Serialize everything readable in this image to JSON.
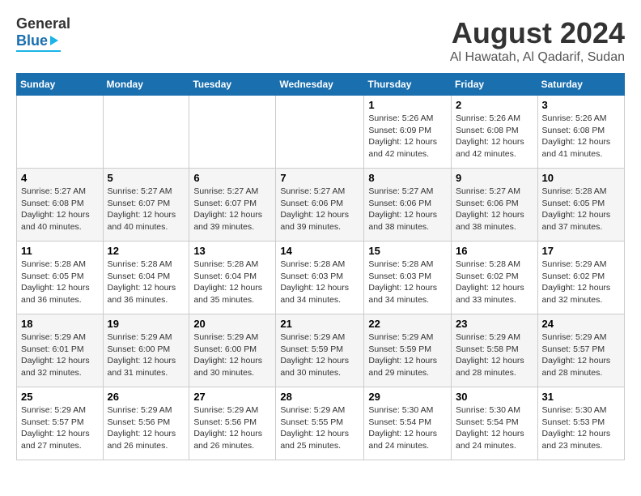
{
  "header": {
    "logo_general": "General",
    "logo_blue": "Blue",
    "title": "August 2024",
    "subtitle": "Al Hawatah, Al Qadarif, Sudan"
  },
  "calendar": {
    "days_of_week": [
      "Sunday",
      "Monday",
      "Tuesday",
      "Wednesday",
      "Thursday",
      "Friday",
      "Saturday"
    ],
    "weeks": [
      [
        {
          "day": "",
          "info": ""
        },
        {
          "day": "",
          "info": ""
        },
        {
          "day": "",
          "info": ""
        },
        {
          "day": "",
          "info": ""
        },
        {
          "day": "1",
          "info": "Sunrise: 5:26 AM\nSunset: 6:09 PM\nDaylight: 12 hours\nand 42 minutes."
        },
        {
          "day": "2",
          "info": "Sunrise: 5:26 AM\nSunset: 6:08 PM\nDaylight: 12 hours\nand 42 minutes."
        },
        {
          "day": "3",
          "info": "Sunrise: 5:26 AM\nSunset: 6:08 PM\nDaylight: 12 hours\nand 41 minutes."
        }
      ],
      [
        {
          "day": "4",
          "info": "Sunrise: 5:27 AM\nSunset: 6:08 PM\nDaylight: 12 hours\nand 40 minutes."
        },
        {
          "day": "5",
          "info": "Sunrise: 5:27 AM\nSunset: 6:07 PM\nDaylight: 12 hours\nand 40 minutes."
        },
        {
          "day": "6",
          "info": "Sunrise: 5:27 AM\nSunset: 6:07 PM\nDaylight: 12 hours\nand 39 minutes."
        },
        {
          "day": "7",
          "info": "Sunrise: 5:27 AM\nSunset: 6:06 PM\nDaylight: 12 hours\nand 39 minutes."
        },
        {
          "day": "8",
          "info": "Sunrise: 5:27 AM\nSunset: 6:06 PM\nDaylight: 12 hours\nand 38 minutes."
        },
        {
          "day": "9",
          "info": "Sunrise: 5:27 AM\nSunset: 6:06 PM\nDaylight: 12 hours\nand 38 minutes."
        },
        {
          "day": "10",
          "info": "Sunrise: 5:28 AM\nSunset: 6:05 PM\nDaylight: 12 hours\nand 37 minutes."
        }
      ],
      [
        {
          "day": "11",
          "info": "Sunrise: 5:28 AM\nSunset: 6:05 PM\nDaylight: 12 hours\nand 36 minutes."
        },
        {
          "day": "12",
          "info": "Sunrise: 5:28 AM\nSunset: 6:04 PM\nDaylight: 12 hours\nand 36 minutes."
        },
        {
          "day": "13",
          "info": "Sunrise: 5:28 AM\nSunset: 6:04 PM\nDaylight: 12 hours\nand 35 minutes."
        },
        {
          "day": "14",
          "info": "Sunrise: 5:28 AM\nSunset: 6:03 PM\nDaylight: 12 hours\nand 34 minutes."
        },
        {
          "day": "15",
          "info": "Sunrise: 5:28 AM\nSunset: 6:03 PM\nDaylight: 12 hours\nand 34 minutes."
        },
        {
          "day": "16",
          "info": "Sunrise: 5:28 AM\nSunset: 6:02 PM\nDaylight: 12 hours\nand 33 minutes."
        },
        {
          "day": "17",
          "info": "Sunrise: 5:29 AM\nSunset: 6:02 PM\nDaylight: 12 hours\nand 32 minutes."
        }
      ],
      [
        {
          "day": "18",
          "info": "Sunrise: 5:29 AM\nSunset: 6:01 PM\nDaylight: 12 hours\nand 32 minutes."
        },
        {
          "day": "19",
          "info": "Sunrise: 5:29 AM\nSunset: 6:00 PM\nDaylight: 12 hours\nand 31 minutes."
        },
        {
          "day": "20",
          "info": "Sunrise: 5:29 AM\nSunset: 6:00 PM\nDaylight: 12 hours\nand 30 minutes."
        },
        {
          "day": "21",
          "info": "Sunrise: 5:29 AM\nSunset: 5:59 PM\nDaylight: 12 hours\nand 30 minutes."
        },
        {
          "day": "22",
          "info": "Sunrise: 5:29 AM\nSunset: 5:59 PM\nDaylight: 12 hours\nand 29 minutes."
        },
        {
          "day": "23",
          "info": "Sunrise: 5:29 AM\nSunset: 5:58 PM\nDaylight: 12 hours\nand 28 minutes."
        },
        {
          "day": "24",
          "info": "Sunrise: 5:29 AM\nSunset: 5:57 PM\nDaylight: 12 hours\nand 28 minutes."
        }
      ],
      [
        {
          "day": "25",
          "info": "Sunrise: 5:29 AM\nSunset: 5:57 PM\nDaylight: 12 hours\nand 27 minutes."
        },
        {
          "day": "26",
          "info": "Sunrise: 5:29 AM\nSunset: 5:56 PM\nDaylight: 12 hours\nand 26 minutes."
        },
        {
          "day": "27",
          "info": "Sunrise: 5:29 AM\nSunset: 5:56 PM\nDaylight: 12 hours\nand 26 minutes."
        },
        {
          "day": "28",
          "info": "Sunrise: 5:29 AM\nSunset: 5:55 PM\nDaylight: 12 hours\nand 25 minutes."
        },
        {
          "day": "29",
          "info": "Sunrise: 5:30 AM\nSunset: 5:54 PM\nDaylight: 12 hours\nand 24 minutes."
        },
        {
          "day": "30",
          "info": "Sunrise: 5:30 AM\nSunset: 5:54 PM\nDaylight: 12 hours\nand 24 minutes."
        },
        {
          "day": "31",
          "info": "Sunrise: 5:30 AM\nSunset: 5:53 PM\nDaylight: 12 hours\nand 23 minutes."
        }
      ]
    ]
  }
}
